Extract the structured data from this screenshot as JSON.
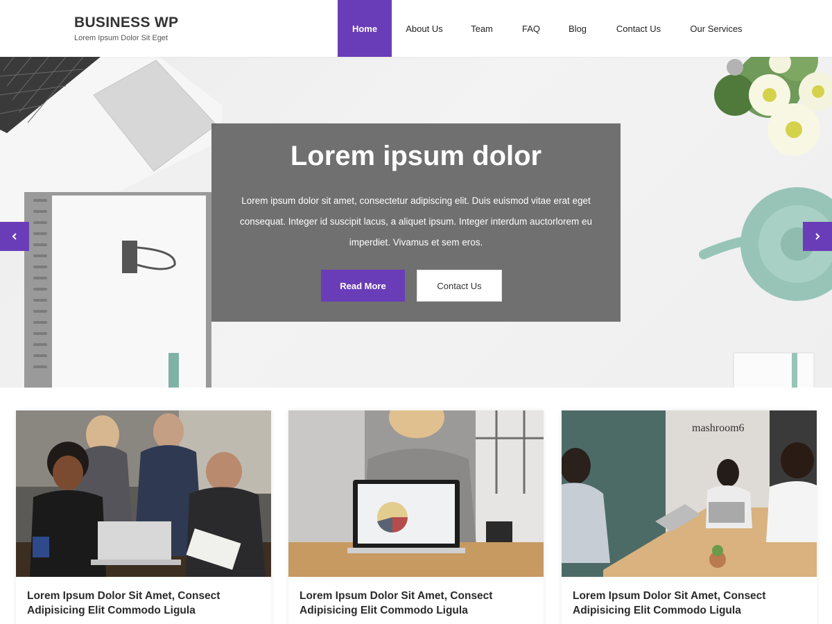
{
  "brand": {
    "title": "BUSINESS WP",
    "tagline": "Lorem Ipsum Dolor Sit Eget"
  },
  "nav": {
    "items": [
      {
        "label": "Home",
        "active": true
      },
      {
        "label": "About Us"
      },
      {
        "label": "Team"
      },
      {
        "label": "FAQ"
      },
      {
        "label": "Blog"
      },
      {
        "label": "Contact Us"
      },
      {
        "label": "Our Services"
      }
    ]
  },
  "hero": {
    "title": "Lorem ipsum dolor",
    "text": "Lorem ipsum dolor sit amet, consectetur adipiscing elit. Duis euismod vitae erat eget consequat. Integer id suscipit lacus, a aliquet ipsum. Integer interdum auctorlorem eu imperdiet. Vivamus et sem eros.",
    "primary_button": "Read More",
    "secondary_button": "Contact Us",
    "prev_icon": "chevron-left-icon",
    "next_icon": "chevron-right-icon"
  },
  "cards": [
    {
      "title": "Lorem Ipsum Dolor Sit Amet, Consect Adipisicing Elit Commodo Ligula"
    },
    {
      "title": "Lorem Ipsum Dolor Sit Amet, Consect Adipisicing Elit Commodo Ligula"
    },
    {
      "title": "Lorem Ipsum Dolor Sit Amet, Consect Adipisicing Elit Commodo Ligula",
      "photo_sign": "mashroom6"
    }
  ],
  "colors": {
    "accent": "#6a3db8",
    "hero_overlay": "#626262"
  }
}
